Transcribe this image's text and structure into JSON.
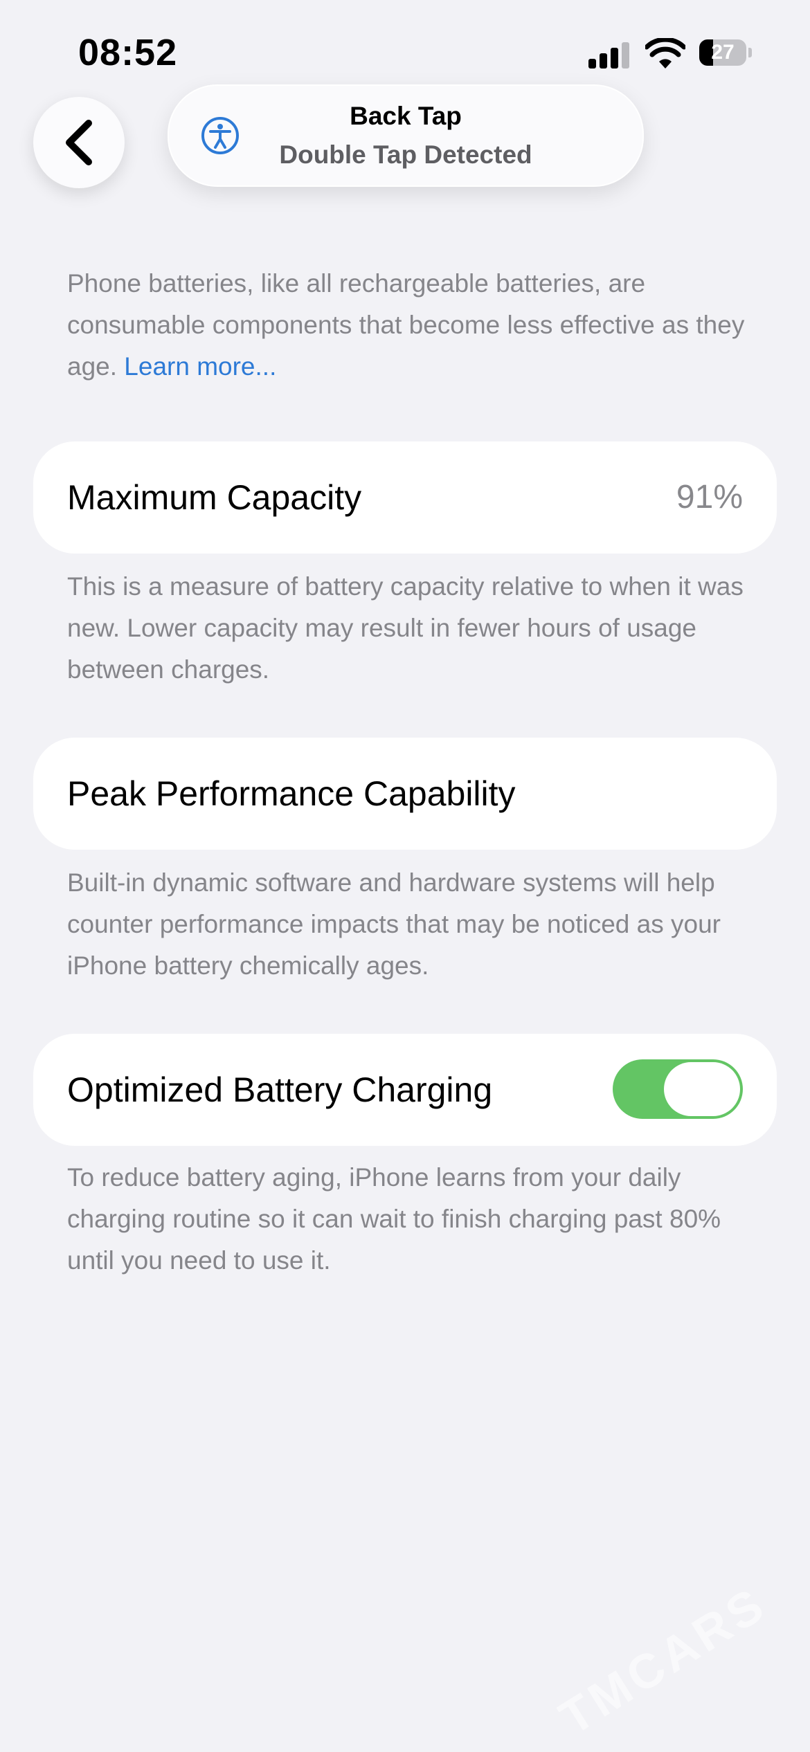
{
  "status_bar": {
    "time": "08:52",
    "battery_level": "27"
  },
  "nav": {
    "back_icon": "chevron-left-icon"
  },
  "banner": {
    "icon": "accessibility-icon",
    "title": "Back Tap",
    "subtitle": "Double Tap Detected"
  },
  "intro": {
    "text": "Phone batteries, like all rechargeable batteries, are consumable components that become less effective as they age. ",
    "link_label": "Learn more..."
  },
  "maximum_capacity": {
    "label": "Maximum Capacity",
    "value": "91%",
    "description": "This is a measure of battery capacity relative to when it was new. Lower capacity may result in fewer hours of usage between charges."
  },
  "peak_performance": {
    "label": "Peak Performance Capability",
    "description": "Built-in dynamic software and hardware systems will help counter performance impacts that may be noticed as your iPhone battery chemically ages."
  },
  "optimized_charging": {
    "label": "Optimized Battery Charging",
    "enabled": true,
    "description": "To reduce battery aging, iPhone learns from your daily charging routine so it can wait to finish charging past 80% until you need to use it."
  },
  "watermark": "TMCARS",
  "colors": {
    "background": "#f2f2f6",
    "link": "#2d7ad6",
    "toggle_on": "#63c564",
    "secondary_text": "#85858a"
  }
}
